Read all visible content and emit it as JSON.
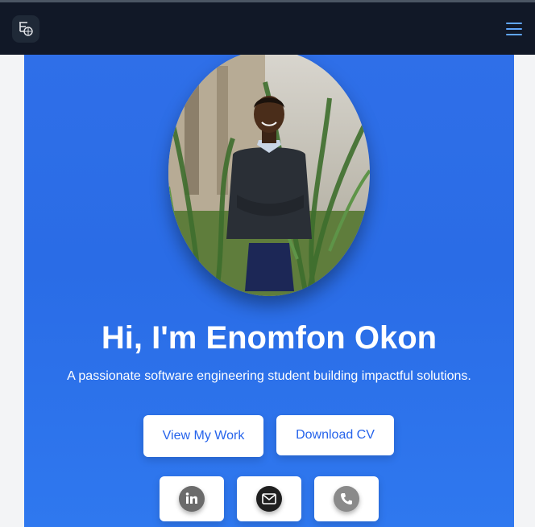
{
  "navbar": {
    "logo_icon": "logo-icon",
    "menu_icon": "hamburger-menu-icon",
    "background": "#111827",
    "accent": "#60a5fa"
  },
  "hero": {
    "title": "Hi, I'm Enomfon Okon",
    "subtitle": "A passionate software engineering student building impactful solutions.",
    "background": "#2f6fe8",
    "buttons": {
      "view_work": "View My Work",
      "download_cv": "Download CV"
    },
    "social": [
      {
        "icon": "linkedin-icon"
      },
      {
        "icon": "mail-icon"
      },
      {
        "icon": "phone-icon"
      }
    ]
  }
}
